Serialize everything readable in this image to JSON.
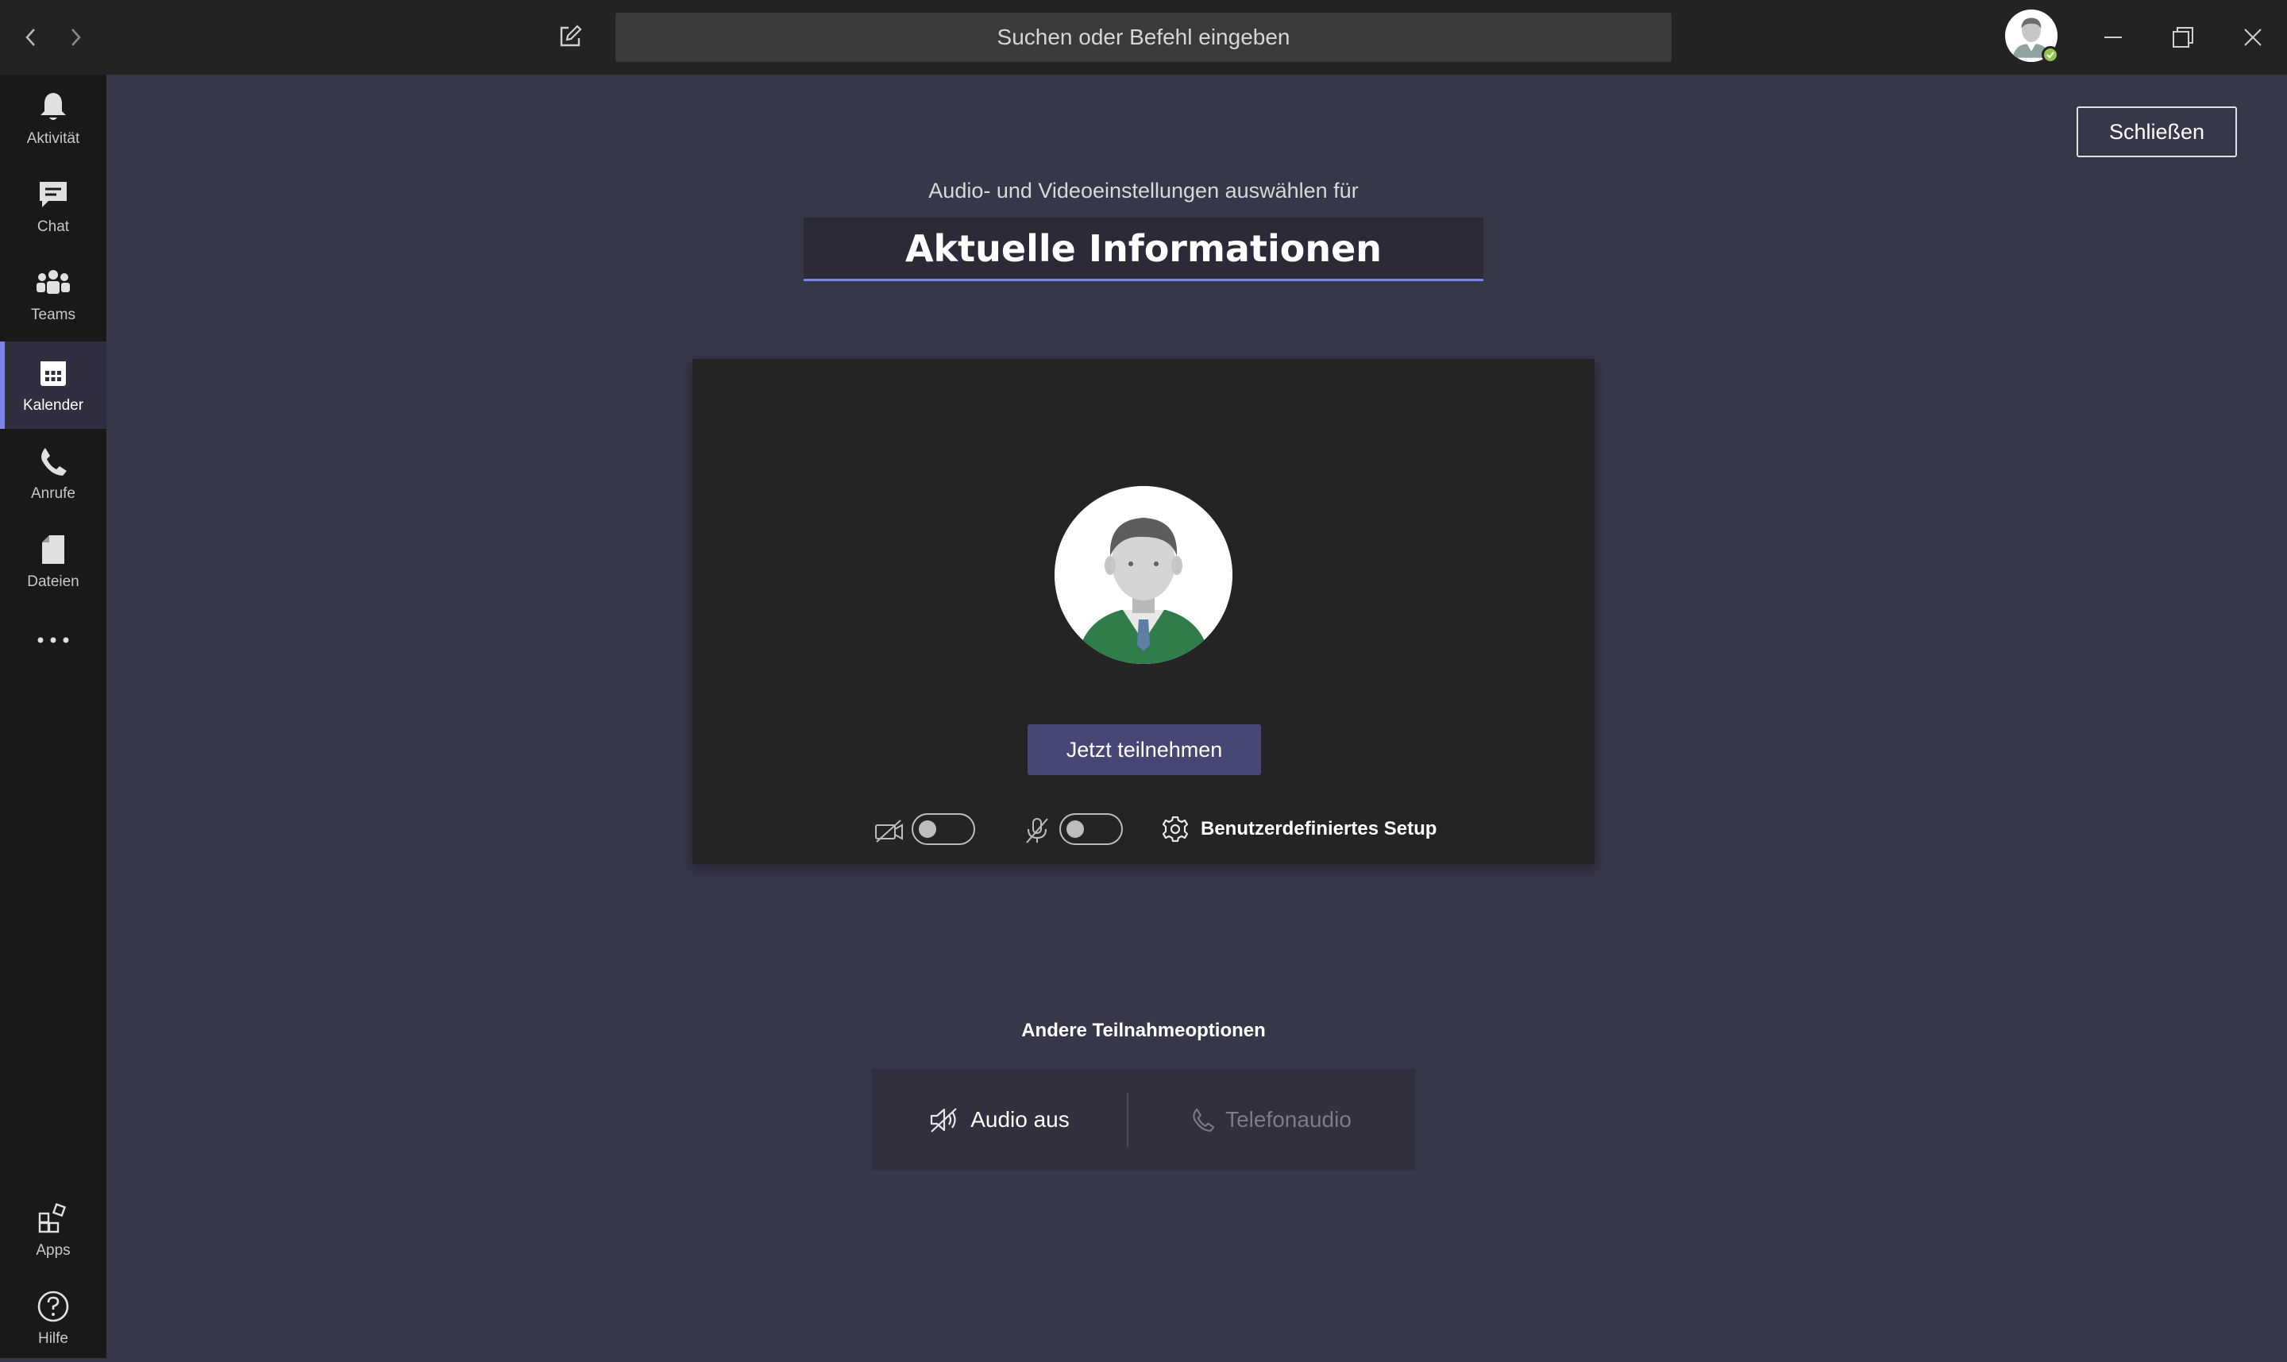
{
  "titlebar": {
    "search_placeholder": "Suchen oder Befehl eingeben",
    "back_icon": "chevron-left-icon",
    "forward_icon": "chevron-right-icon",
    "compose_icon": "compose-icon",
    "presence_status_color": "#92c353"
  },
  "rail": {
    "items": [
      {
        "label": "Aktivität",
        "icon": "bell-icon"
      },
      {
        "label": "Chat",
        "icon": "chat-icon"
      },
      {
        "label": "Teams",
        "icon": "teams-icon"
      },
      {
        "label": "Kalender",
        "icon": "calendar-icon",
        "active": true
      },
      {
        "label": "Anrufe",
        "icon": "phone-icon"
      },
      {
        "label": "Dateien",
        "icon": "file-icon"
      }
    ],
    "more_icon": "more-icon",
    "bottom": [
      {
        "label": "Apps",
        "icon": "apps-icon"
      },
      {
        "label": "Hilfe",
        "icon": "help-icon"
      }
    ]
  },
  "main": {
    "close_label": "Schließen",
    "subtitle": "Audio- und Videoeinstellungen auswählen für",
    "meeting_title": "Aktuelle Informationen",
    "join_label": "Jetzt teilnehmen",
    "custom_setup_label": "Benutzerdefiniertes Setup",
    "camera_on": false,
    "mic_on": false,
    "other_options_label": "Andere Teilnahmeoptionen",
    "options": [
      {
        "label": "Audio aus",
        "icon": "speaker-off-icon",
        "enabled": true
      },
      {
        "label": "Telefonaudio",
        "icon": "phone-icon",
        "enabled": false
      }
    ]
  },
  "colors": {
    "accent": "#7b83eb",
    "join_button": "#464775",
    "background": "#37374a"
  }
}
